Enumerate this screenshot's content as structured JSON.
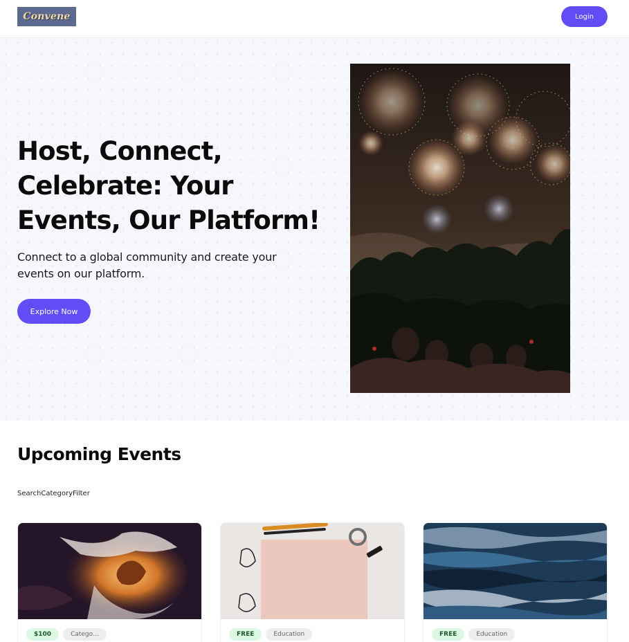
{
  "header": {
    "logo_text": "Convene",
    "login_label": "Login"
  },
  "hero": {
    "title": "Host, Connect, Celebrate: Your Events, Our Platform!",
    "subtitle": "Connect to a global community and create your events on our platform.",
    "cta_label": "Explore Now",
    "image": "fireworks-crowd-photo"
  },
  "events": {
    "title": "Upcoming Events",
    "search_label": "Search",
    "category_filter_label": "CategoryFilter",
    "cards": [
      {
        "price": "$100",
        "category": "Catego...",
        "image": "orange-marble-swirl"
      },
      {
        "price": "FREE",
        "category": "Education",
        "image": "paper-and-pencils"
      },
      {
        "price": "FREE",
        "category": "Education",
        "image": "blue-ocean-paint"
      }
    ]
  },
  "colors": {
    "accent": "#624cf5",
    "hero_bg": "#f6f7fc",
    "price_tag_bg": "#dcf7e3",
    "category_tag_bg": "#eeeeee"
  }
}
